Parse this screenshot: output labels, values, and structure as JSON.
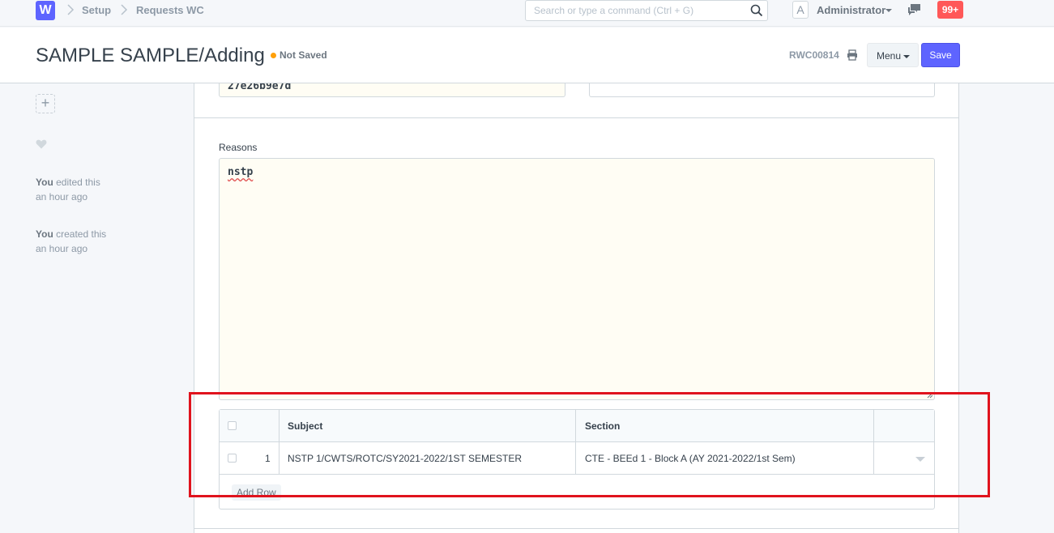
{
  "navbar": {
    "logo": "W",
    "breadcrumbs": [
      "Setup",
      "Requests WC"
    ],
    "search_placeholder": "Search or type a command (Ctrl + G)",
    "avatar_letter": "A",
    "user": "Administrator",
    "notification_count": "99+"
  },
  "page": {
    "title": "SAMPLE SAMPLE/Adding",
    "status": "Not Saved",
    "doc_name": "RWC00814",
    "menu_label": "Menu",
    "save_label": "Save"
  },
  "sidebar": {
    "timeline": [
      {
        "who": "You",
        "action": "edited this",
        "when": "an hour ago"
      },
      {
        "who": "You",
        "action": "created this",
        "when": "an hour ago"
      }
    ]
  },
  "form": {
    "hash_value": "27e26b9e7d",
    "reasons_label": "Reasons",
    "reasons_value": "nstp",
    "grid": {
      "columns": [
        "Subject",
        "Section"
      ],
      "rows": [
        {
          "idx": "1",
          "subject": "NSTP 1/CWTS/ROTC/SY2021-2022/1ST SEMESTER",
          "section": "CTE - BEEd 1 - Block A (AY 2021-2022/1st Sem)"
        }
      ],
      "add_row_label": "Add Row"
    }
  },
  "colors": {
    "primary": "#5e64ff",
    "highlight": "#e0131d",
    "notification": "#ff5858",
    "status_dot": "#ffa00a"
  }
}
